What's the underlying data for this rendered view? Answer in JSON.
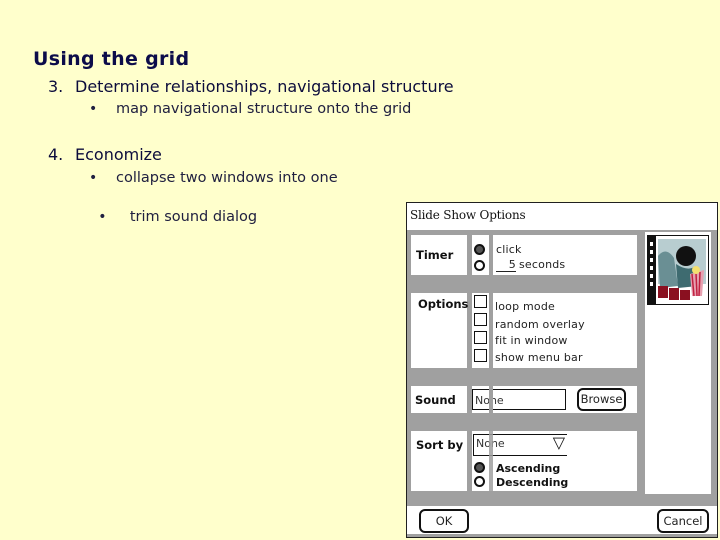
{
  "slide": {
    "title": "Using the grid",
    "items": [
      {
        "number": "3.",
        "text": "Determine relationships, navigational structure",
        "bullets": [
          "map navigational structure onto the grid"
        ]
      },
      {
        "number": "4.",
        "text": "Economize",
        "bullets": [
          "collapse two windows into one",
          " trim sound dialog"
        ]
      }
    ],
    "bullet_glyph": "•"
  },
  "dialog": {
    "title": "Slide Show Options",
    "timer": {
      "label": "Timer",
      "options": [
        {
          "label": "click",
          "selected": true
        },
        {
          "label": "seconds",
          "value": "5",
          "selected": false
        }
      ]
    },
    "options": {
      "label": "Options",
      "checkboxes": [
        {
          "label": "loop mode",
          "checked": false
        },
        {
          "label": "random overlay",
          "checked": false
        },
        {
          "label": "fit in window",
          "checked": false
        },
        {
          "label": "show menu bar",
          "checked": false
        }
      ]
    },
    "sound": {
      "label": "Sound",
      "value": "None",
      "browse_label": "Browse"
    },
    "sort": {
      "label": "Sort by",
      "selected": "None",
      "dropdown_icon": "▽",
      "orders": [
        {
          "label": "Ascending",
          "selected": true
        },
        {
          "label": "Descending",
          "selected": false
        }
      ]
    },
    "ok_label": "OK",
    "cancel_label": "Cancel",
    "preview_icon": "movie-clipart"
  }
}
